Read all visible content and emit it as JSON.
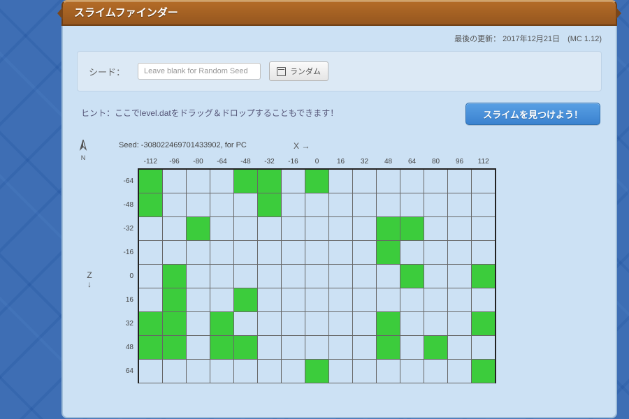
{
  "header": {
    "title": "スライムファインダー",
    "last_update": "最後の更新： 2017年12月21日　(MC 1.12)"
  },
  "seedbox": {
    "label": "シード：",
    "placeholder": "Leave blank for Random Seed",
    "value": "",
    "random_btn": "ランダム"
  },
  "hint": "ヒント：ここでlevel.datをドラッグ＆ドロップすることもできます！",
  "find_btn": "スライムを見つけよう！",
  "map": {
    "compass_n": "N",
    "seed_line": "Seed: -308022469701433902, for PC",
    "x_label": "X →",
    "z_label": "Z\n↓",
    "x_ticks": [
      -112,
      -96,
      -80,
      -64,
      -48,
      -32,
      -16,
      0,
      16,
      32,
      48,
      64,
      80,
      96,
      112
    ],
    "z_ticks": [
      -64,
      -48,
      -32,
      -16,
      0,
      16,
      32,
      48,
      64
    ],
    "cell_size_chunks": 16,
    "slime_cells": [
      [
        -64,
        -112
      ],
      [
        -64,
        -48
      ],
      [
        -64,
        -32
      ],
      [
        -64,
        0
      ],
      [
        -48,
        -112
      ],
      [
        -48,
        -32
      ],
      [
        -32,
        -80
      ],
      [
        -32,
        48
      ],
      [
        -32,
        64
      ],
      [
        -16,
        48
      ],
      [
        0,
        -96
      ],
      [
        0,
        64
      ],
      [
        0,
        112
      ],
      [
        16,
        -96
      ],
      [
        16,
        -48
      ],
      [
        32,
        -112
      ],
      [
        32,
        -96
      ],
      [
        32,
        -64
      ],
      [
        32,
        48
      ],
      [
        32,
        112
      ],
      [
        48,
        -112
      ],
      [
        48,
        -96
      ],
      [
        48,
        -64
      ],
      [
        48,
        -48
      ],
      [
        48,
        48
      ],
      [
        48,
        80
      ],
      [
        64,
        0
      ],
      [
        64,
        112
      ]
    ]
  }
}
